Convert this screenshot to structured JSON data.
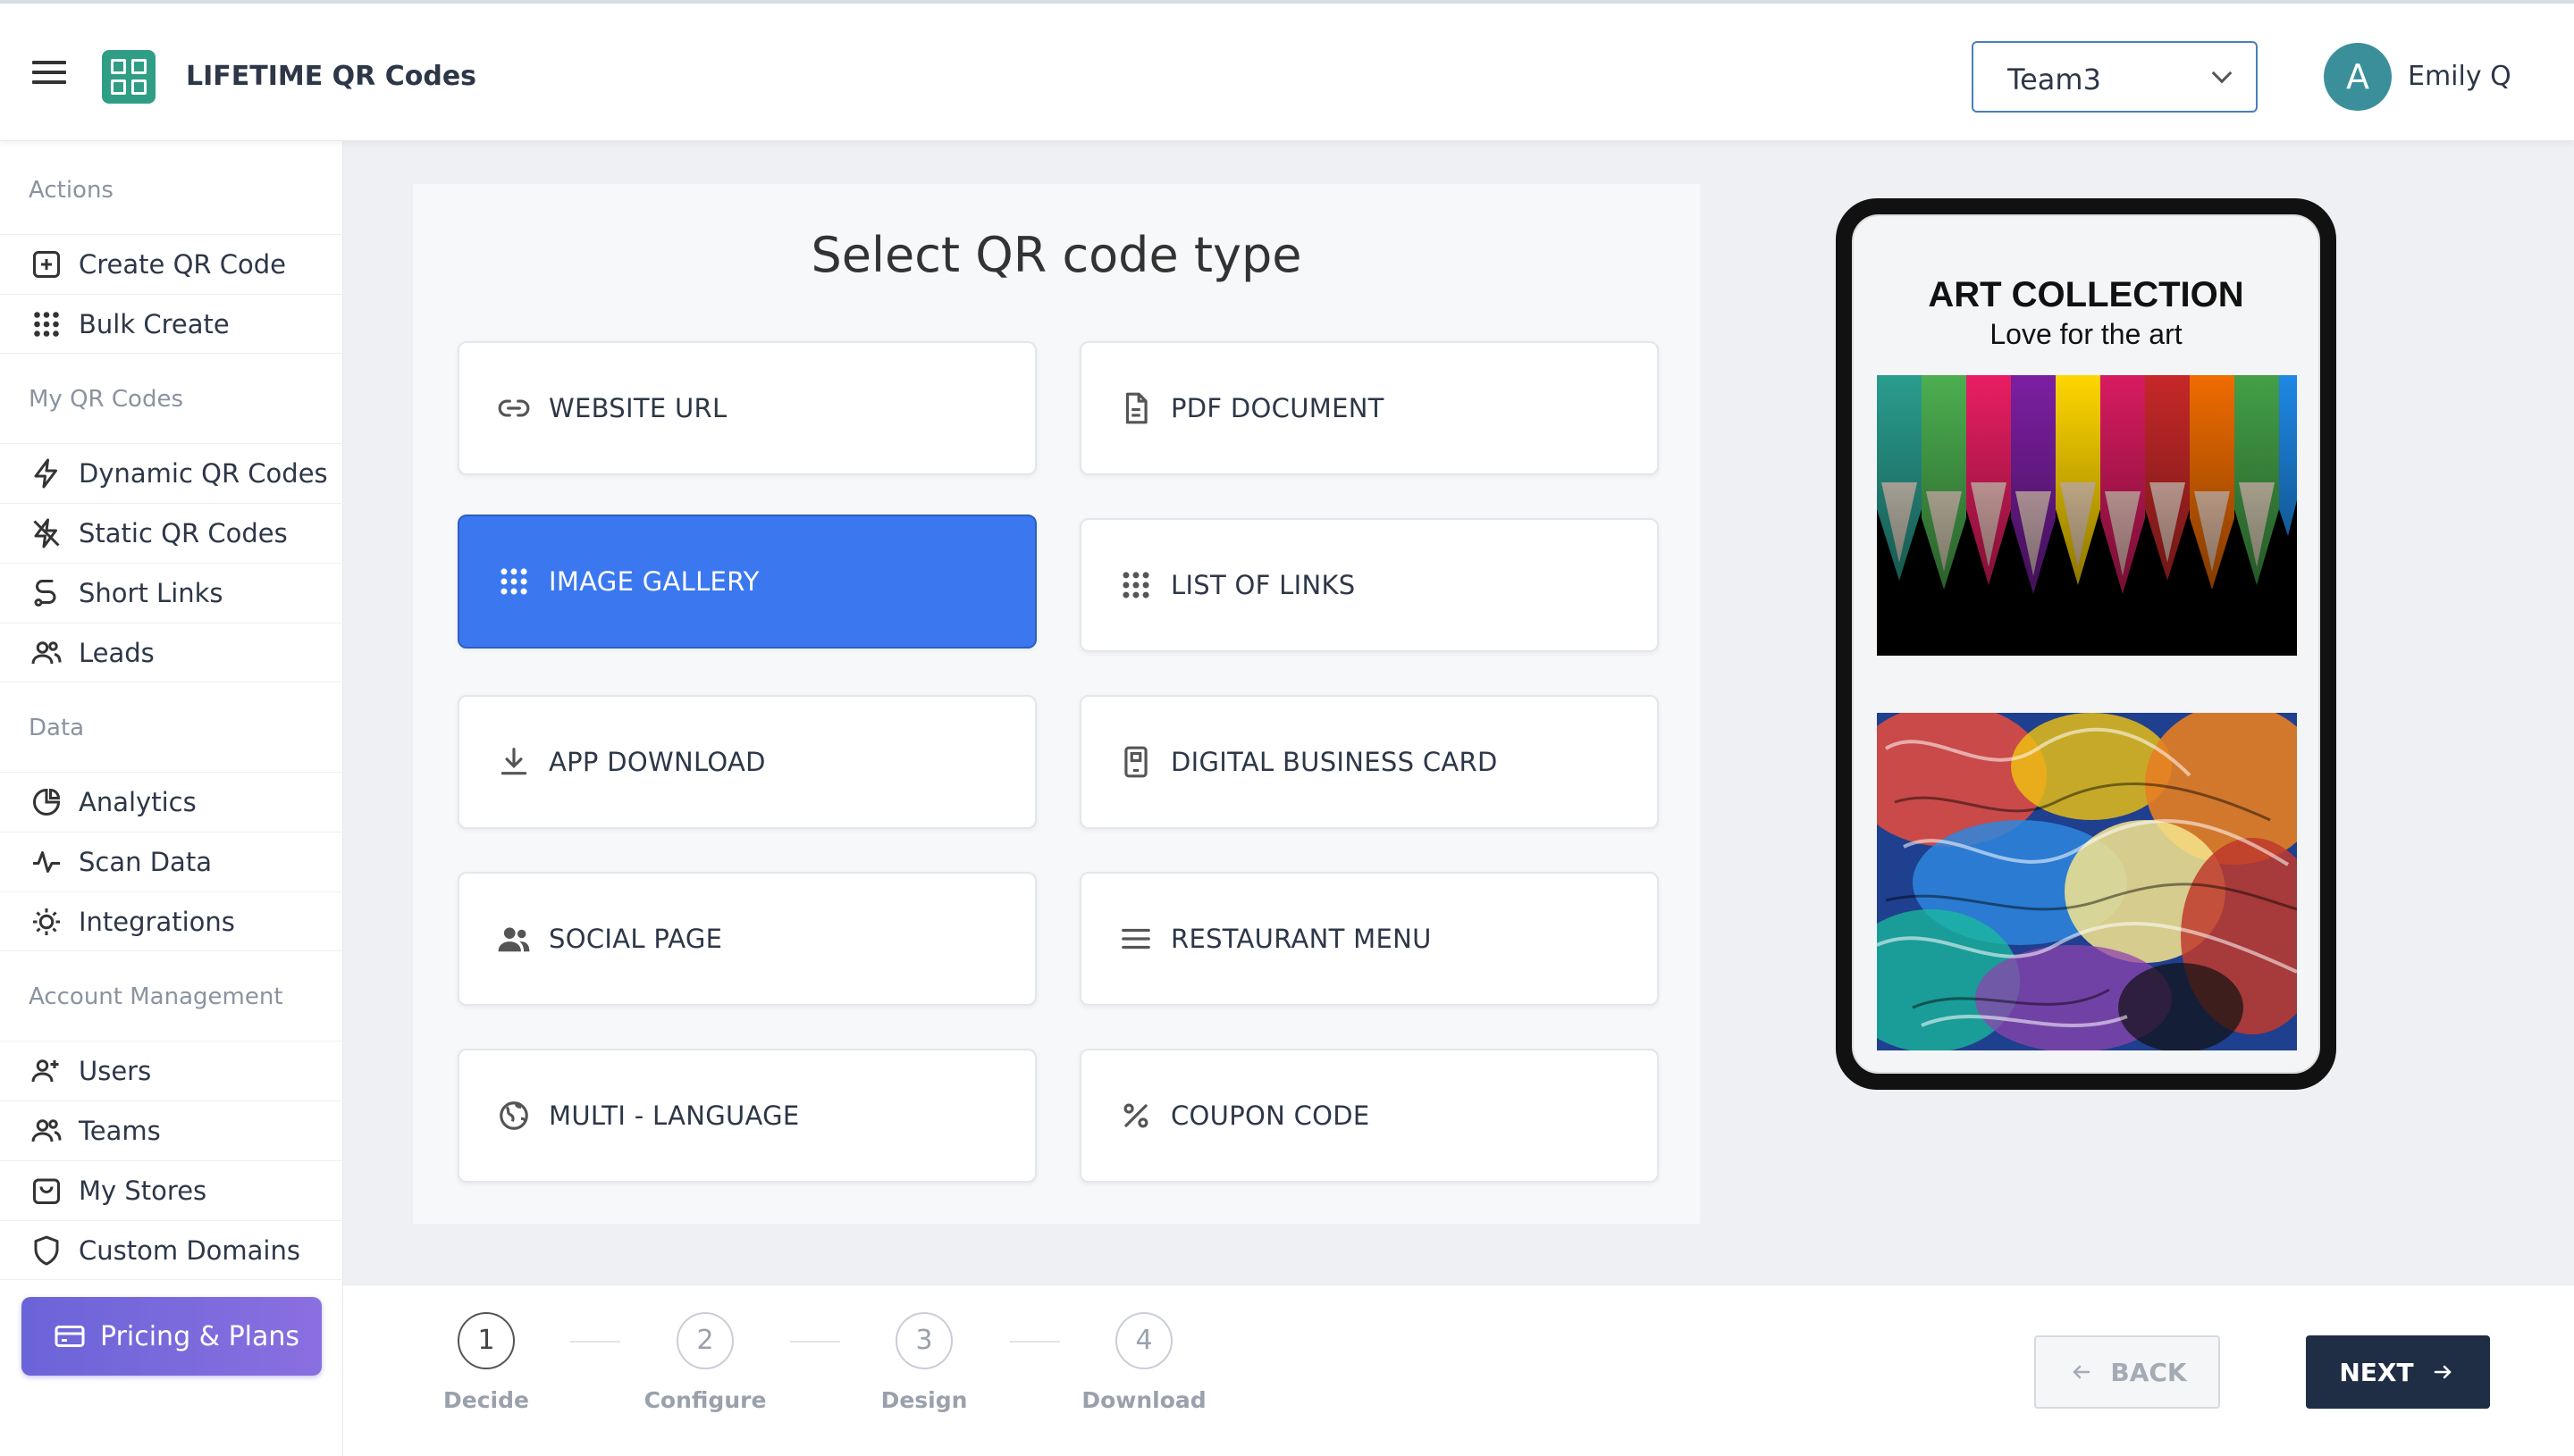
{
  "header": {
    "app_title": "LIFETIME QR Codes",
    "team_selected": "Team3",
    "avatar_letter": "A",
    "user_name": "Emily Q"
  },
  "sidebar": {
    "sections": {
      "actions": "Actions",
      "my_qr_codes": "My QR Codes",
      "data": "Data",
      "account": "Account Management"
    },
    "items": {
      "create_qr": "Create QR Code",
      "bulk_create": "Bulk Create",
      "dynamic_qr": "Dynamic QR Codes",
      "static_qr": "Static QR Codes",
      "short_links": "Short Links",
      "leads": "Leads",
      "analytics": "Analytics",
      "scan_data": "Scan Data",
      "integrations": "Integrations",
      "users": "Users",
      "teams": "Teams",
      "my_stores": "My Stores",
      "custom_domains": "Custom Domains"
    },
    "pricing_label": "Pricing & Plans"
  },
  "main": {
    "title": "Select QR code type",
    "types": {
      "website_url": "WEBSITE URL",
      "pdf_document": "PDF DOCUMENT",
      "image_gallery": "IMAGE GALLERY",
      "list_of_links": "LIST OF LINKS",
      "app_download": "APP DOWNLOAD",
      "digital_business_card": "DIGITAL BUSINESS CARD",
      "social_page": "SOCIAL PAGE",
      "restaurant_menu": "RESTAURANT MENU",
      "multi_language": "MULTI - LANGUAGE",
      "coupon_code": "COUPON CODE"
    },
    "selected_type": "IMAGE GALLERY"
  },
  "preview": {
    "title": "ART COLLECTION",
    "subtitle": "Love for the art"
  },
  "stepper": {
    "steps": [
      {
        "num": "1",
        "label": "Decide"
      },
      {
        "num": "2",
        "label": "Configure"
      },
      {
        "num": "3",
        "label": "Design"
      },
      {
        "num": "4",
        "label": "Download"
      }
    ],
    "active_step": "1"
  },
  "footer": {
    "back_label": "BACK",
    "next_label": "NEXT"
  },
  "colors": {
    "accent_blue": "#3b78f0",
    "logo_green": "#2f9e84",
    "pricing_purple": "#6a64d8",
    "next_navy": "#1f2e44"
  }
}
